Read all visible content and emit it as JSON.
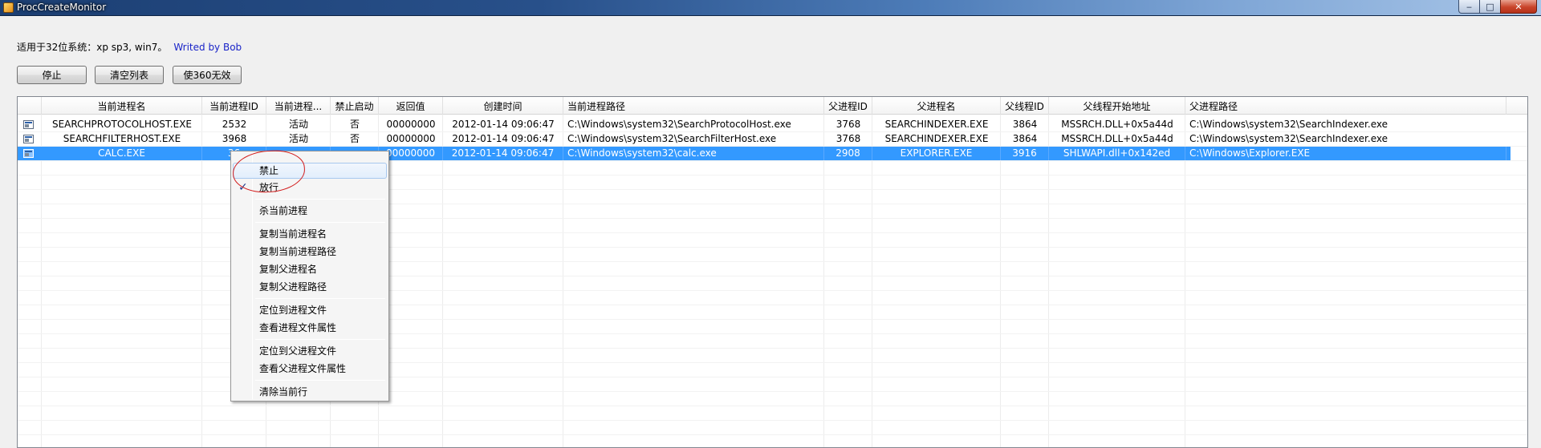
{
  "window": {
    "title": "ProcCreateMonitor",
    "controls": {
      "minimize": "‒",
      "maximize": "□",
      "close": "✕"
    }
  },
  "info": {
    "text": "适用于32位系统：xp sp3, win7。",
    "author": "Writed by Bob"
  },
  "toolbar": {
    "stop_label": "停止",
    "clear_label": "清空列表",
    "disable360_label": "使360无效"
  },
  "list": {
    "columns": [
      "当前进程名",
      "当前进程ID",
      "当前进程...",
      "禁止启动",
      "返回值",
      "创建时间",
      "当前进程路径",
      "父进程ID",
      "父进程名",
      "父线程ID",
      "父线程开始地址",
      "父进程路径"
    ],
    "rows": [
      [
        "SEARCHPROTOCOLHOST.EXE",
        "2532",
        "活动",
        "否",
        "00000000",
        "2012-01-14 09:06:47",
        "C:\\Windows\\system32\\SearchProtocolHost.exe",
        "3768",
        "SEARCHINDEXER.EXE",
        "3864",
        "MSSRCH.DLL+0x5a44d",
        "C:\\Windows\\system32\\SearchIndexer.exe"
      ],
      [
        "SEARCHFILTERHOST.EXE",
        "3968",
        "活动",
        "否",
        "00000000",
        "2012-01-14 09:06:47",
        "C:\\Windows\\system32\\SearchFilterHost.exe",
        "3768",
        "SEARCHINDEXER.EXE",
        "3864",
        "MSSRCH.DLL+0x5a44d",
        "C:\\Windows\\system32\\SearchIndexer.exe"
      ],
      [
        "CALC.EXE",
        "36",
        "",
        "",
        "00000000",
        "2012-01-14 09:06:47",
        "C:\\Windows\\system32\\calc.exe",
        "2908",
        "EXPLORER.EXE",
        "3916",
        "SHLWAPI.dll+0x142ed",
        "C:\\Windows\\Explorer.EXE"
      ]
    ],
    "selected_row": 2
  },
  "context_menu": {
    "items": {
      "block": "禁止",
      "allow": "放行",
      "kill": "杀当前进程",
      "copy_name": "复制当前进程名",
      "copy_path": "复制当前进程路径",
      "copy_parent_name": "复制父进程名",
      "copy_parent_path": "复制父进程路径",
      "locate_file": "定位到进程文件",
      "file_props": "查看进程文件属性",
      "locate_parent_file": "定位到父进程文件",
      "parent_file_props": "查看父进程文件属性",
      "clear_row": "清除当前行"
    },
    "checked_item": "allow",
    "check_glyph": "✓"
  },
  "colors": {
    "selection": "#3399ff",
    "annotation": "#d21a1a",
    "author": "#1a24c8"
  }
}
